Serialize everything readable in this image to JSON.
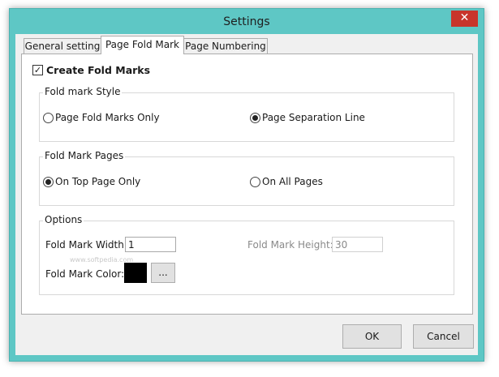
{
  "window": {
    "title": "Settings",
    "close_glyph": "✕"
  },
  "tabs": [
    {
      "label": "General setting"
    },
    {
      "label": "Page Fold Mark"
    },
    {
      "label": "Page Numbering"
    }
  ],
  "create_fold_marks": {
    "label": "Create Fold Marks",
    "checked": true,
    "check_glyph": "✓"
  },
  "style_group": {
    "legend": "Fold mark Style",
    "options": [
      {
        "label": "Page Fold Marks Only",
        "selected": false
      },
      {
        "label": "Page Separation Line",
        "selected": true
      }
    ]
  },
  "pages_group": {
    "legend": "Fold Mark Pages",
    "options": [
      {
        "label": "On Top Page Only",
        "selected": true
      },
      {
        "label": "On All Pages",
        "selected": false
      }
    ]
  },
  "options_group": {
    "legend": "Options",
    "width_label": "Fold Mark Width:",
    "width_value": "1",
    "height_label": "Fold Mark Height:",
    "height_value": "30",
    "color_label": "Fold Mark Color:",
    "color_value": "#000000",
    "color_button": "...",
    "watermark": "www.softpedia.com"
  },
  "footer": {
    "ok": "OK",
    "cancel": "Cancel"
  }
}
